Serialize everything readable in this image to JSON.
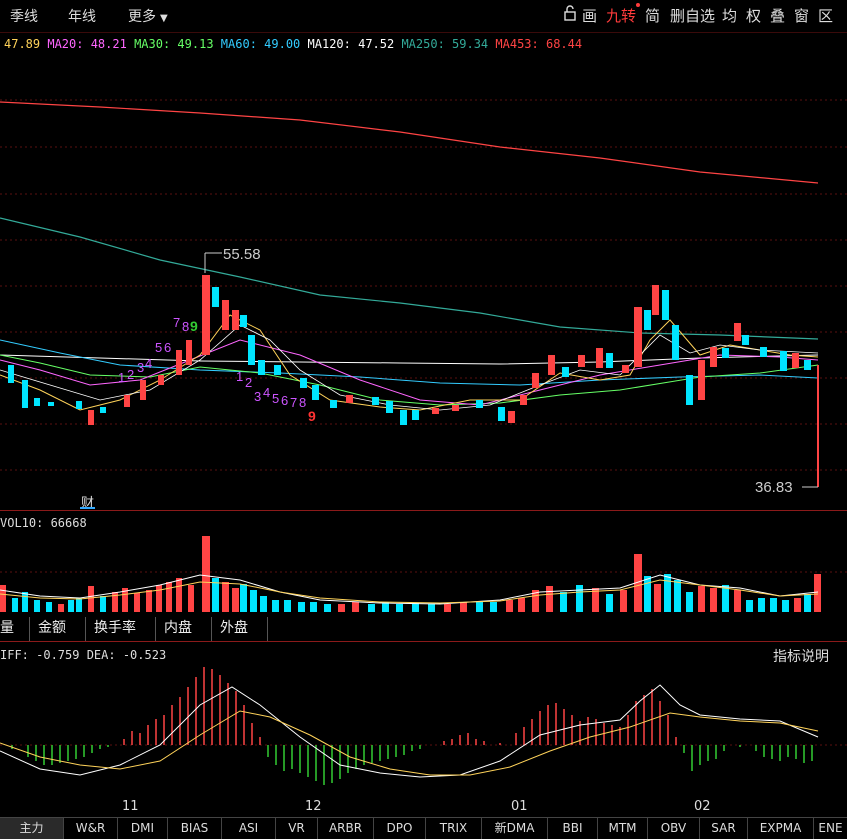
{
  "toolbar": {
    "periods": [
      "季线",
      "年线"
    ],
    "more_label": "更多",
    "tools": [
      "画",
      "九转",
      "简",
      "删自选",
      "均",
      "权",
      "叠",
      "窗",
      "区"
    ]
  },
  "ma_legend": [
    {
      "label": "47.89",
      "color": "#ffd35a"
    },
    {
      "label": "MA20: 48.21",
      "color": "#ff66ff"
    },
    {
      "label": "MA30: 49.13",
      "color": "#66ff66"
    },
    {
      "label": "MA60: 49.00",
      "color": "#33ccff"
    },
    {
      "label": "MA120: 47.52",
      "color": "#ffffff"
    },
    {
      "label": "MA250: 59.34",
      "color": "#33aa99"
    },
    {
      "label": "MA453: 68.44",
      "color": "#ff4444"
    }
  ],
  "price_annotations": {
    "high": "55.58",
    "low": "36.83"
  },
  "td_sequence": {
    "up1": [
      "1",
      "2",
      "3",
      "4"
    ],
    "up2": [
      "5",
      "6"
    ],
    "up3": [
      "7",
      "8",
      "9"
    ],
    "down1": [
      "1",
      "2"
    ],
    "down2": [
      "3",
      "4",
      "5",
      "6",
      "7",
      "8"
    ],
    "down_final": "9"
  },
  "finance_marker": "财",
  "volume": {
    "label": "VOL10: 66668"
  },
  "sub_tabs": [
    "量",
    "金额",
    "换手率",
    "内盘",
    "外盘"
  ],
  "macd": {
    "label": "IFF: -0.759 DEA: -0.523",
    "help": "指标说明"
  },
  "months": [
    "11",
    "12",
    "01",
    "02"
  ],
  "bottom_tabs": [
    "主力",
    "W&R",
    "DMI",
    "BIAS",
    "ASI",
    "VR",
    "ARBR",
    "DPO",
    "TRIX",
    "新DMA",
    "BBI",
    "MTM",
    "OBV",
    "SAR",
    "EXPMA",
    "ENE"
  ],
  "colors": {
    "up": "#ff4444",
    "down": "#00e5ff",
    "grid": "#5a0f0f",
    "accent": "#ff3b3b"
  }
}
